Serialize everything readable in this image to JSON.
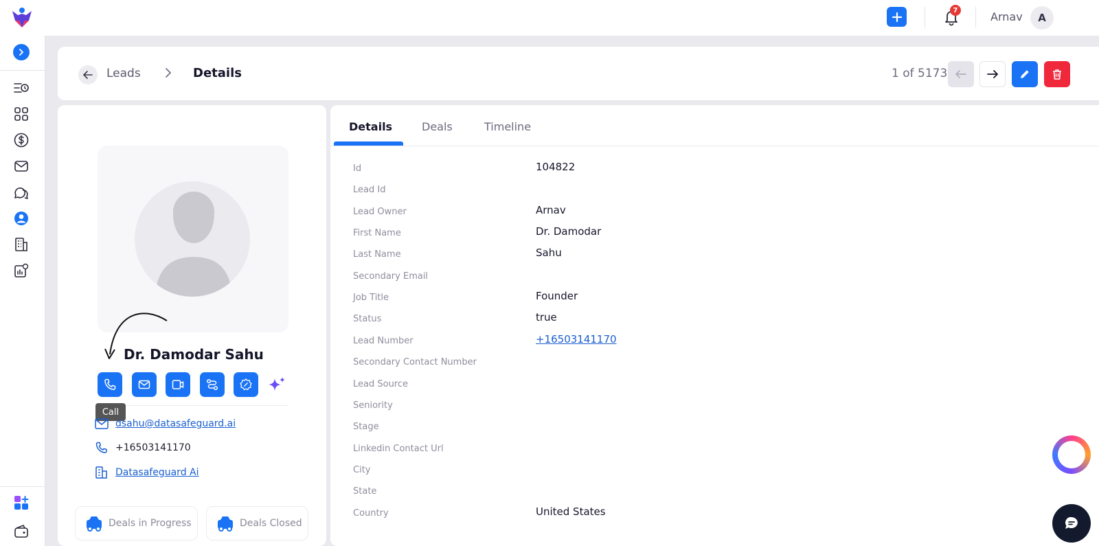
{
  "topbar": {
    "notification_count": "7",
    "user_name": "Arnav",
    "user_initial": "A"
  },
  "sidebar": {
    "items": [
      {
        "icon": "menu-clock-icon"
      },
      {
        "icon": "grid-icon"
      },
      {
        "icon": "dollar-icon"
      },
      {
        "icon": "mail-icon"
      },
      {
        "icon": "chat-bubbles-icon"
      },
      {
        "icon": "user-circle-icon",
        "active": true
      },
      {
        "icon": "building-icon"
      },
      {
        "icon": "report-settings-icon"
      }
    ],
    "bottom": [
      {
        "icon": "apps-add-icon"
      },
      {
        "icon": "wallet-icon"
      }
    ]
  },
  "header": {
    "breadcrumb_parent": "Leads",
    "breadcrumb_current": "Details",
    "pager": "1 of 5173"
  },
  "lead": {
    "name": "Dr. Damodar Sahu",
    "tooltip": "Call",
    "email": "dsahu@datasafeguard.ai",
    "phone": "+16503141170",
    "company": "Datasafeguard Ai"
  },
  "deals": {
    "in_progress_label": "Deals in Progress",
    "closed_label": "Deals Closed"
  },
  "tabs": [
    "Details",
    "Deals",
    "Timeline"
  ],
  "fields": [
    {
      "label": "Id",
      "value": "104822"
    },
    {
      "label": "Lead Id",
      "value": ""
    },
    {
      "label": "Lead Owner",
      "value": "Arnav"
    },
    {
      "label": "First Name",
      "value": "Dr. Damodar"
    },
    {
      "label": "Last Name",
      "value": "Sahu"
    },
    {
      "label": "Secondary Email",
      "value": ""
    },
    {
      "label": "Job Title",
      "value": "Founder"
    },
    {
      "label": "Status",
      "value": "true"
    },
    {
      "label": "Lead Number",
      "value": "+16503141170"
    },
    {
      "label": "Secondary Contact Number",
      "value": ""
    },
    {
      "label": "Lead Source",
      "value": ""
    },
    {
      "label": "Seniority",
      "value": ""
    },
    {
      "label": "Stage",
      "value": ""
    },
    {
      "label": "Linkedin Contact Url",
      "value": ""
    },
    {
      "label": "City",
      "value": ""
    },
    {
      "label": "State",
      "value": ""
    },
    {
      "label": "Country",
      "value": "United States"
    }
  ],
  "colors": {
    "accent": "#1a73f5",
    "danger": "#f0283c",
    "badge": "#e53935"
  }
}
